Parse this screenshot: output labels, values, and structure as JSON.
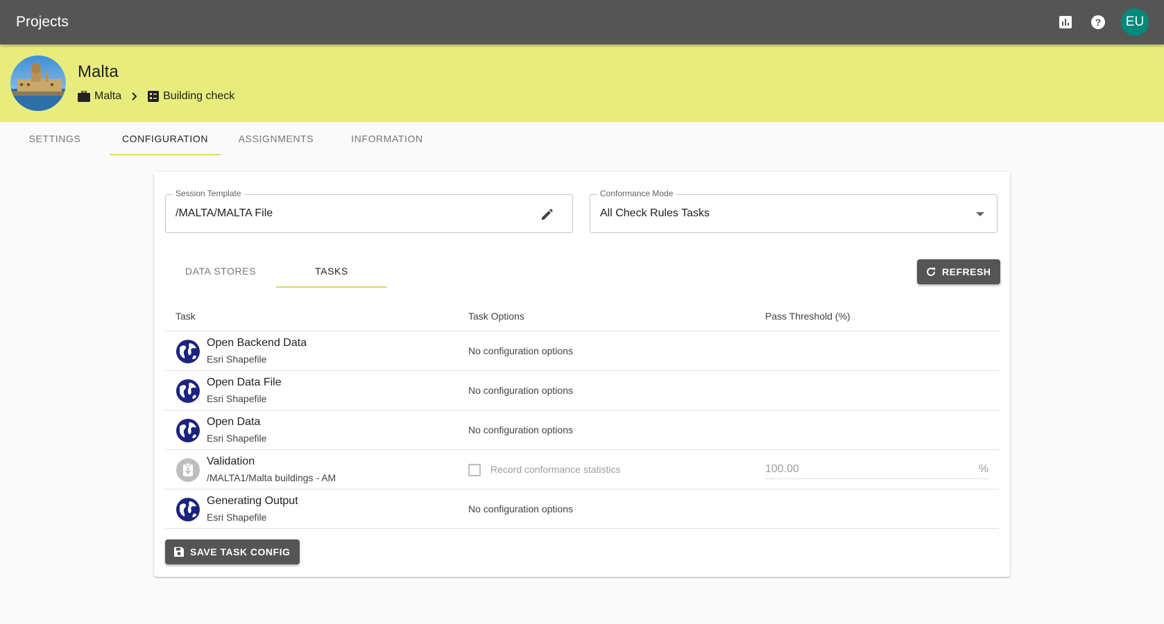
{
  "appbar": {
    "title": "Projects",
    "icons": [
      "bar-chart-icon",
      "help-icon"
    ],
    "avatar_initials": "EU",
    "background": "#555555",
    "avatar_color": "#00897b"
  },
  "project": {
    "name": "Malta",
    "header_color": "#e8ec7d",
    "breadcrumb": [
      {
        "icon": "briefcase-icon",
        "label": "Malta"
      },
      {
        "icon": "checklist-icon",
        "label": "Building check"
      }
    ]
  },
  "main_tabs": [
    {
      "label": "SETTINGS",
      "active": false
    },
    {
      "label": "CONFIGURATION",
      "active": true
    },
    {
      "label": "ASSIGNMENTS",
      "active": false
    },
    {
      "label": "INFORMATION",
      "active": false
    }
  ],
  "session_template": {
    "label": "Session Template",
    "value": "/MALTA/MALTA File"
  },
  "conformance_mode": {
    "label": "Conformance Mode",
    "value": "All Check Rules Tasks"
  },
  "sub_tabs": [
    {
      "label": "DATA STORES",
      "active": false
    },
    {
      "label": "TASKS",
      "active": true
    }
  ],
  "refresh_label": "REFRESH",
  "table": {
    "headers": [
      "Task",
      "Task Options",
      "Pass Threshold (%)"
    ],
    "rows": [
      {
        "name": "Open Backend Data",
        "sub": "Esri Shapefile",
        "icon": "globe-icon",
        "option": "No configuration options"
      },
      {
        "name": "Open Data File",
        "sub": "Esri Shapefile",
        "icon": "globe-icon",
        "option": "No configuration options"
      },
      {
        "name": "Open Data",
        "sub": "Esri Shapefile",
        "icon": "globe-icon",
        "option": "No configuration options"
      },
      {
        "name": "Validation",
        "sub": "/MALTA1/Malta buildings - AM",
        "icon": "clipboard-icon",
        "checkbox_label": "Record conformance statistics",
        "checked": false,
        "threshold": "100.00",
        "threshold_unit": "%"
      },
      {
        "name": "Generating Output",
        "sub": "Esri Shapefile",
        "icon": "globe-icon",
        "option": "No configuration options"
      }
    ]
  },
  "save_label": "SAVE TASK CONFIG",
  "accent_color": "#d4dc5a"
}
